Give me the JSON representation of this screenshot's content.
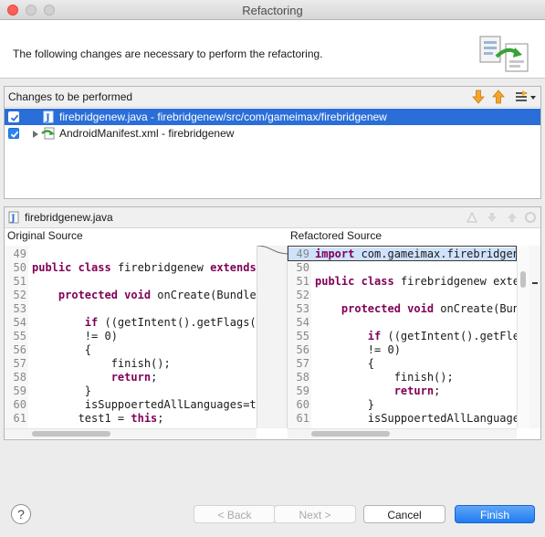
{
  "window": {
    "title": "Refactoring"
  },
  "header": {
    "message": "The following changes are necessary to perform the refactoring."
  },
  "changes": {
    "title": "Changes to be performed",
    "items": [
      {
        "label": "firebridgenew.java - firebridgenew/src/com/gameimax/firebridgenew",
        "checked": true,
        "selected": true
      },
      {
        "label": "AndroidManifest.xml - firebridgenew",
        "checked": true,
        "selected": false
      }
    ]
  },
  "compare": {
    "file_name": "firebridgenew.java",
    "left_title": "Original Source",
    "right_title": "Refactored Source",
    "left_lines": [
      {
        "n": "49",
        "t": ""
      },
      {
        "n": "50",
        "t": "public class firebridgenew extends A"
      },
      {
        "n": "51",
        "t": ""
      },
      {
        "n": "52",
        "t": "    protected void onCreate(Bundle s"
      },
      {
        "n": "53",
        "t": ""
      },
      {
        "n": "54",
        "t": "        if ((getIntent().getFlags()"
      },
      {
        "n": "55",
        "t": "        != 0)"
      },
      {
        "n": "56",
        "t": "        {"
      },
      {
        "n": "57",
        "t": "            finish();"
      },
      {
        "n": "58",
        "t": "            return;"
      },
      {
        "n": "59",
        "t": "        }"
      },
      {
        "n": "60",
        "t": "        isSuppoertedAllLanguages=tr"
      },
      {
        "n": "61",
        "t": "       test1 = this;"
      }
    ],
    "right_lines": [
      {
        "n": "49",
        "t": "import com.gameimax.firebridgene"
      },
      {
        "n": "50",
        "t": ""
      },
      {
        "n": "51",
        "t": "public class firebridgenew exter"
      },
      {
        "n": "52",
        "t": ""
      },
      {
        "n": "53",
        "t": "    protected void onCreate(Bund"
      },
      {
        "n": "54",
        "t": ""
      },
      {
        "n": "55",
        "t": "        if ((getIntent().getFle"
      },
      {
        "n": "56",
        "t": "        != 0)"
      },
      {
        "n": "57",
        "t": "        {"
      },
      {
        "n": "58",
        "t": "            finish();"
      },
      {
        "n": "59",
        "t": "            return;"
      },
      {
        "n": "60",
        "t": "        }"
      },
      {
        "n": "61",
        "t": "        isSuppoertedAllLanguage"
      }
    ]
  },
  "buttons": {
    "help": "?",
    "back": "< Back",
    "next": "Next >",
    "cancel": "Cancel",
    "finish": "Finish"
  },
  "colors": {
    "selection": "#2a6ed8",
    "primary_button": "#1f7cf2",
    "keyword": "#7f0055"
  }
}
